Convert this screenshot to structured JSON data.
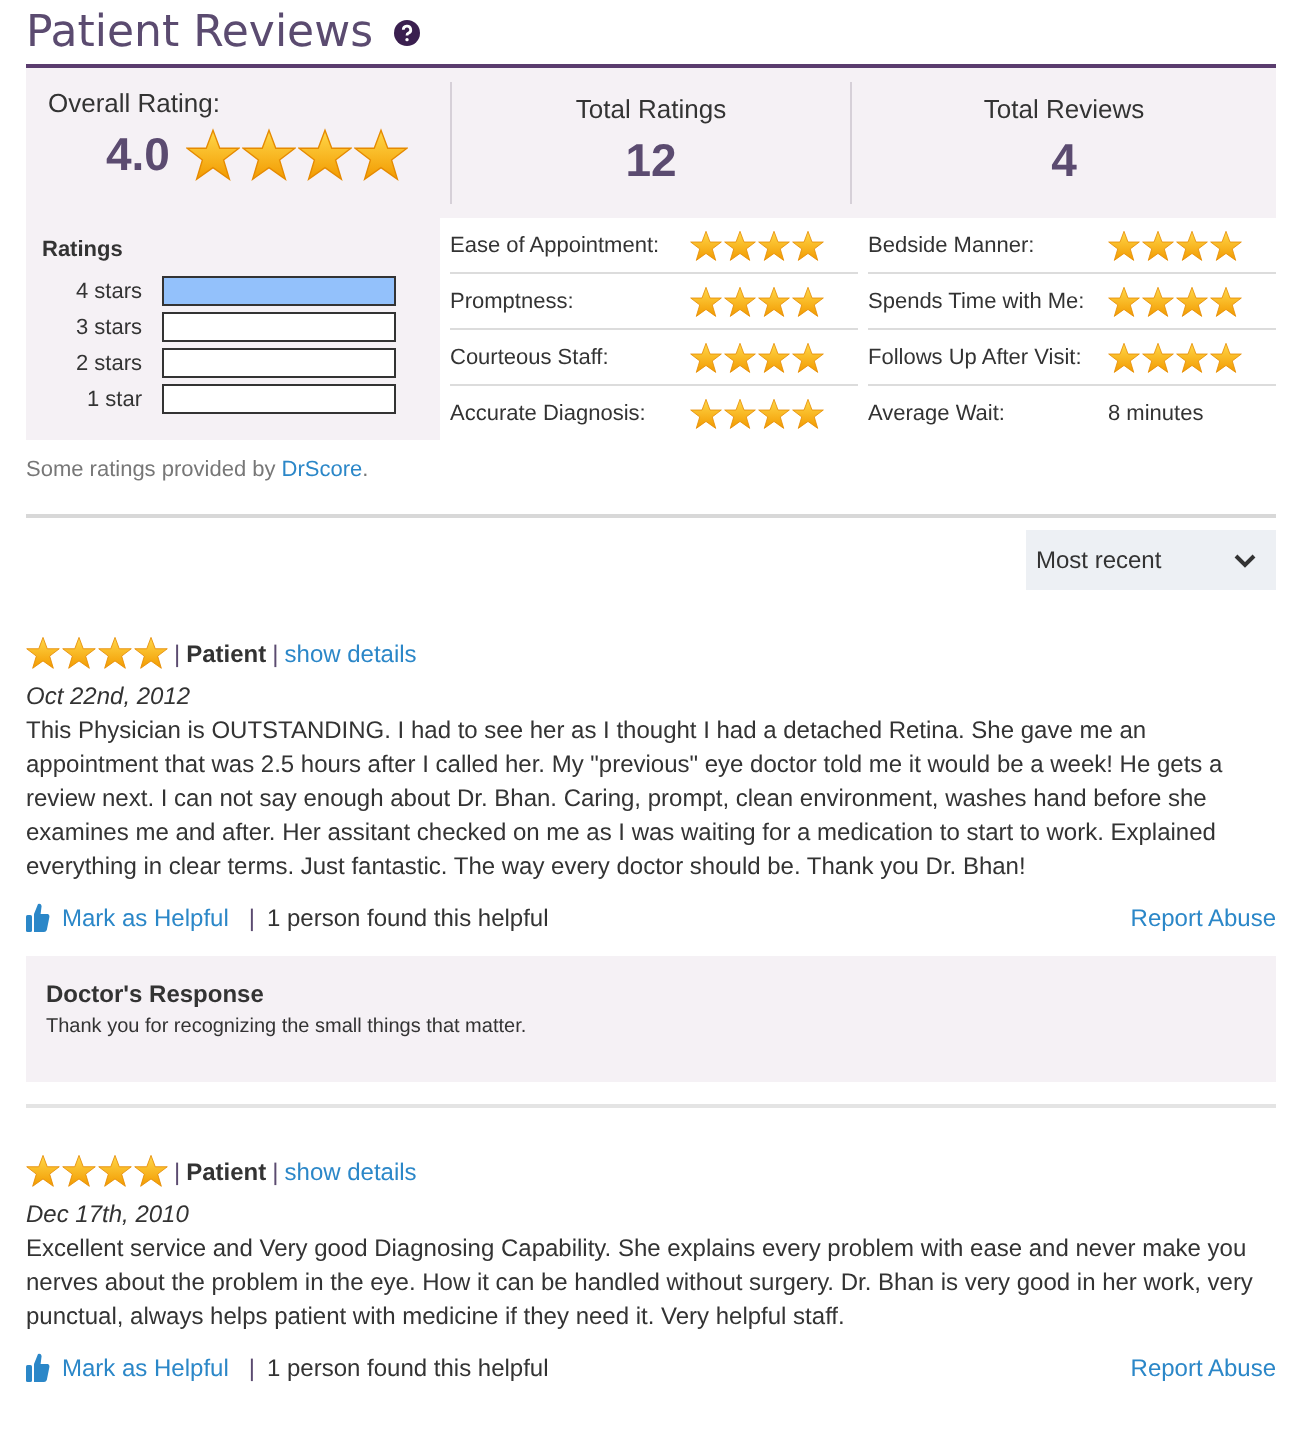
{
  "heading": {
    "title": "Patient Reviews"
  },
  "overall": {
    "label": "Overall Rating:",
    "value": "4.0",
    "stars": 4
  },
  "summary": {
    "total_ratings_label": "Total Ratings",
    "total_ratings": "12",
    "total_reviews_label": "Total Reviews",
    "total_reviews": "4"
  },
  "distribution": {
    "title": "Ratings",
    "rows": [
      {
        "label": "4 stars",
        "filled": true
      },
      {
        "label": "3 stars",
        "filled": false
      },
      {
        "label": "2 stars",
        "filled": false
      },
      {
        "label": "1 star",
        "filled": false
      }
    ]
  },
  "categories": [
    {
      "label": "Ease of Appointment:",
      "kind": "stars",
      "stars": 4
    },
    {
      "label": "Bedside Manner:",
      "kind": "stars",
      "stars": 4
    },
    {
      "label": "Promptness:",
      "kind": "stars",
      "stars": 4
    },
    {
      "label": "Spends Time with Me:",
      "kind": "stars",
      "stars": 4
    },
    {
      "label": "Courteous Staff:",
      "kind": "stars",
      "stars": 4
    },
    {
      "label": "Follows Up After Visit:",
      "kind": "stars",
      "stars": 4
    },
    {
      "label": "Accurate Diagnosis:",
      "kind": "stars",
      "stars": 4
    },
    {
      "label": "Average Wait:",
      "kind": "text",
      "value": "8 minutes"
    }
  ],
  "source_note": {
    "text": "Some ratings provided by",
    "link": "DrScore",
    "end": "."
  },
  "sort": {
    "value": "Most recent"
  },
  "reviews": [
    {
      "stars": 4,
      "sep_author": "|",
      "author": "Patient",
      "sep_details": "|",
      "details_link": "show details",
      "date": "Oct 22nd, 2012",
      "body": "This Physician is OUTSTANDING. I had to see her as I thought I had a detached Retina. She gave me an appointment that was 2.5 hours after I called her. My \"previous\" eye doctor told me it would be a week! He gets a review next. I can not say enough about Dr. Bhan. Caring, prompt, clean environment, washes hand before she examines me and after. Her assitant checked on me as I was waiting for a medication to start to work. Explained everything in clear terms. Just fantastic. The way every doctor should be. Thank you Dr. Bhan!",
      "helpful_link": "Mark as Helpful",
      "sep_helpful": "|",
      "helpful_count": "1 person found this helpful",
      "report_link": "Report Abuse",
      "response": {
        "title": "Doctor's Response",
        "text": "Thank you for recognizing the small things that matter."
      }
    },
    {
      "stars": 4,
      "sep_author": "|",
      "author": "Patient",
      "sep_details": "|",
      "details_link": "show details",
      "date": "Dec 17th, 2010",
      "body": "Excellent service and Very good Diagnosing Capability. She explains every problem with ease and never make you nerves about the problem in the eye. How it can be handled without surgery. Dr. Bhan is very good in her work, very punctual, always helps patient with medicine if they need it. Very helpful staff.",
      "helpful_link": "Mark as Helpful",
      "sep_helpful": "|",
      "helpful_count": "1 person found this helpful",
      "report_link": "Report Abuse"
    }
  ]
}
